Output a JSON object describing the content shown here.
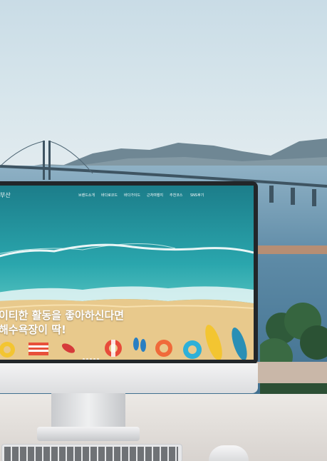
{
  "website": {
    "logo": "부산",
    "nav": [
      "브랜드소개",
      "바다로코드",
      "바다가이드",
      "근처여행지",
      "추천코스",
      "SNS후기"
    ],
    "headline": [
      "이티한 활동을 좋아하신다면",
      "해수욕장이 딱!"
    ],
    "slide_count": 5
  },
  "colors": {
    "sea": "#1f8e96",
    "sand": "#e8c98c",
    "accent_yellow": "#f3c531"
  }
}
